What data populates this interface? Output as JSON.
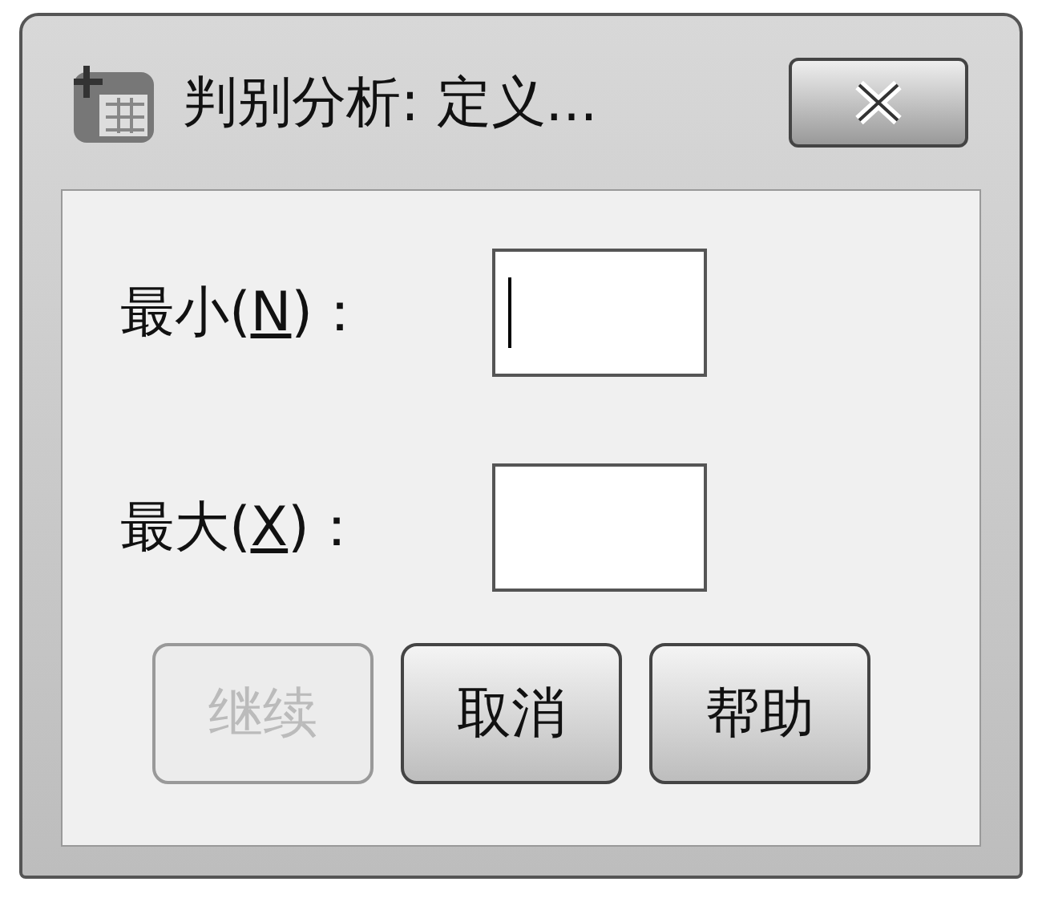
{
  "window": {
    "title": "判别分析: 定义..."
  },
  "fields": [
    {
      "label_prefix": "最小(",
      "mnemonic": "N",
      "label_suffix": ")：",
      "focused": true
    },
    {
      "label_prefix": "最大(",
      "mnemonic": "X",
      "label_suffix": ")："
    }
  ],
  "buttons": [
    {
      "label": "继续",
      "disabled": true
    },
    {
      "label": "取消",
      "disabled": false
    },
    {
      "label": "帮助",
      "disabled": false
    }
  ]
}
